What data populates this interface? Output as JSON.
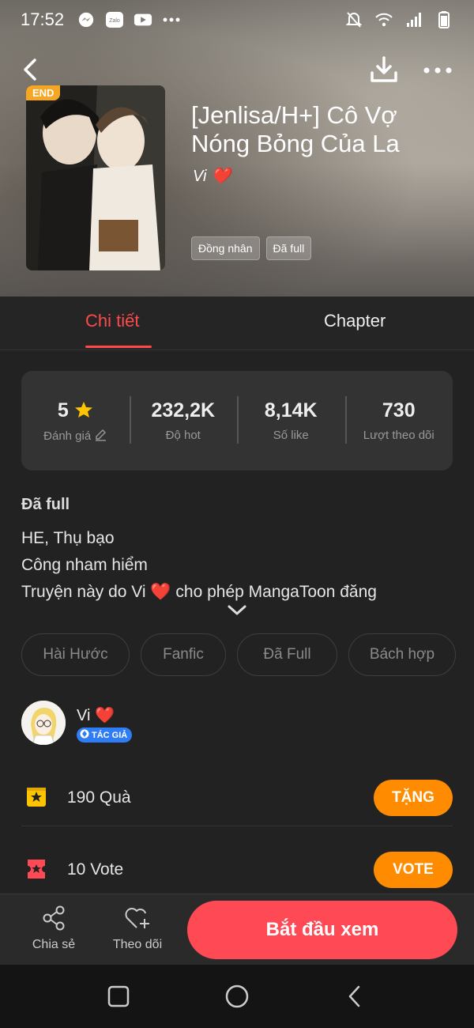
{
  "status_bar": {
    "time": "17:52",
    "left_icons": [
      "messenger-icon",
      "zalo-icon",
      "youtube-icon",
      "more-dots-icon"
    ],
    "right_icons": [
      "mute-bell-icon",
      "wifi-icon",
      "signal-icon",
      "battery-icon"
    ],
    "zalo_label": "Zalo"
  },
  "header": {
    "end_badge": "END",
    "title": "[Jenlisa/H+] Cô Vợ Nóng Bỏng Của La",
    "author": "Vi ❤️",
    "tags": [
      "Đồng nhân",
      "Đã full"
    ]
  },
  "tabs": [
    {
      "label": "Chi tiết",
      "active": true
    },
    {
      "label": "Chapter",
      "active": false
    }
  ],
  "stats": [
    {
      "value": "5",
      "label": "Đánh giá",
      "icon": "star-icon"
    },
    {
      "value": "232,2K",
      "label": "Độ hot"
    },
    {
      "value": "8,14K",
      "label": "Số like"
    },
    {
      "value": "730",
      "label": "Lượt theo dõi"
    }
  ],
  "status_heading": "Đã full",
  "description": [
    "HE, Thụ bạo",
    "Công nham hiểm",
    "Truyện này do Vi ❤️ cho phép MangaToon đăng"
  ],
  "genres": [
    "Hài Hước",
    "Fanfic",
    "Đã Full",
    "Bách hợp"
  ],
  "author_section": {
    "name": "Vi ❤️",
    "badge": "TÁC GIẢ"
  },
  "gift": {
    "count_text": "190  Quà",
    "button": "TẶNG"
  },
  "vote": {
    "count_text": "10  Vote",
    "button": "VOTE"
  },
  "actions": {
    "share_label": "Chia sẻ",
    "follow_label": "Theo dõi",
    "start_button": "Bắt đầu xem"
  },
  "colors": {
    "accent_red": "#ff4a4a",
    "button_orange": "#ff8c00",
    "start_button": "#ff4a55",
    "background": "#222222"
  }
}
